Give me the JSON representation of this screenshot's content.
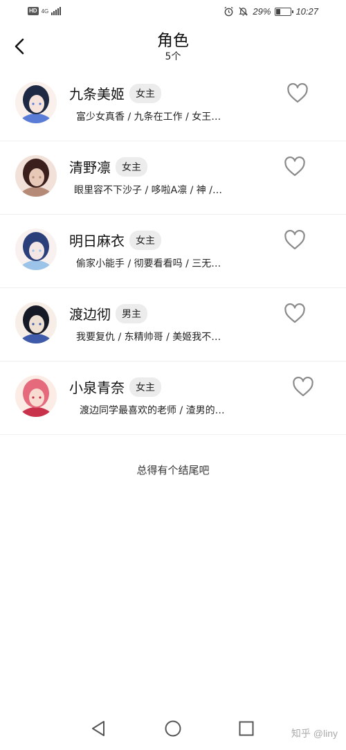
{
  "status_bar": {
    "hd": "HD",
    "network": "4G",
    "battery_text": "29%",
    "battery_level": 0.29,
    "time": "10:27",
    "icons": [
      "alarm-icon",
      "mute-icon",
      "battery-icon"
    ]
  },
  "header": {
    "title": "角色",
    "subtitle": "5个"
  },
  "characters": [
    {
      "name": "九条美姬",
      "tag": "女主",
      "desc": "富少女真香 / 九条在工作 / 女王…",
      "favorited": false,
      "avatar_colors": [
        "#1e2a44",
        "#f6e3dc",
        "#5a7bd6"
      ]
    },
    {
      "name": "清野凛",
      "tag": "女主",
      "desc": "眼里容不下沙子 / 哆啦A凛 / 神 /…",
      "favorited": false,
      "avatar_colors": [
        "#3a1f1c",
        "#e8c9b8",
        "#b58a77"
      ]
    },
    {
      "name": "明日麻衣",
      "tag": "女主",
      "desc": "偷家小能手 / 彻要看看吗 / 三无…",
      "favorited": false,
      "avatar_colors": [
        "#2b3f7a",
        "#f4e6e4",
        "#9cc4e8"
      ]
    },
    {
      "name": "渡边彻",
      "tag": "男主",
      "desc": "我要复仇 / 东精帅哥 / 美姬我不…",
      "favorited": false,
      "avatar_colors": [
        "#161a26",
        "#efe0d4",
        "#3f5aa8"
      ]
    },
    {
      "name": "小泉青奈",
      "tag": "女主",
      "desc": "渡边同学最喜欢的老师 / 渣男的…",
      "favorited": false,
      "avatar_colors": [
        "#e46a7c",
        "#f8dcd2",
        "#c8324a"
      ]
    }
  ],
  "footer_text": "总得有个结尾吧",
  "nav": {
    "icons": [
      "back-triangle-icon",
      "home-circle-icon",
      "recents-square-icon"
    ]
  },
  "watermark": "知乎 @liny"
}
